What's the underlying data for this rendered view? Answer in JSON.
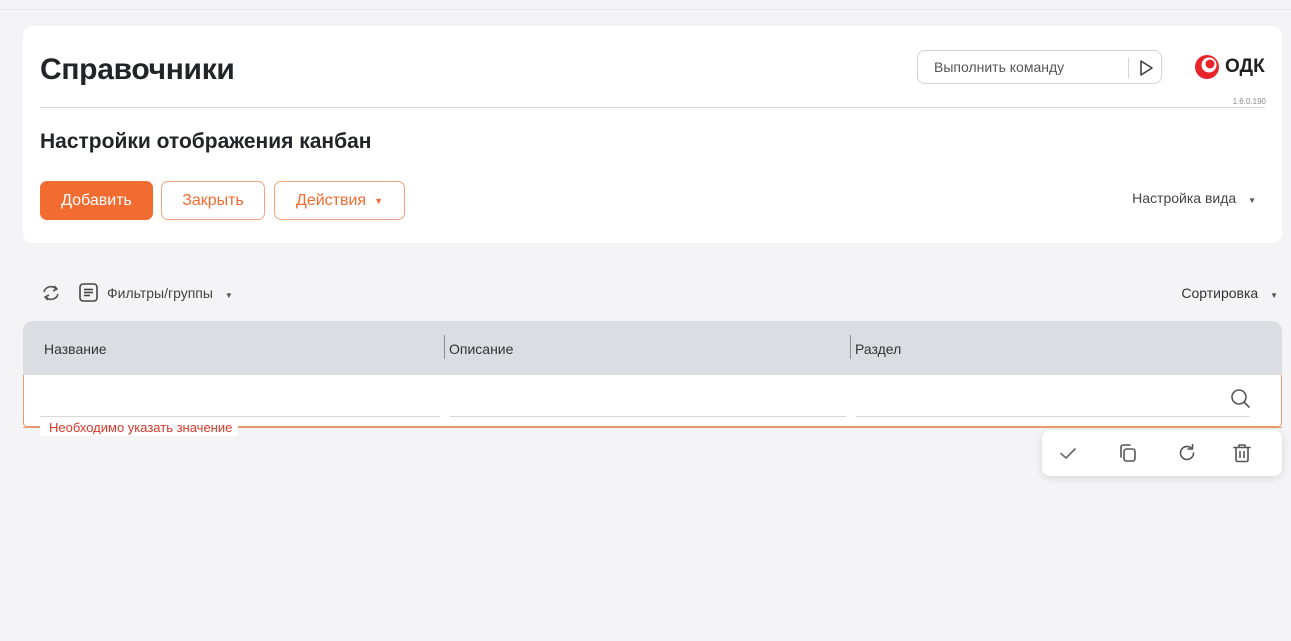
{
  "header": {
    "title": "Справочники",
    "command_placeholder": "Выполнить команду",
    "logo_text": "ОДК",
    "version": "1.6.0.190"
  },
  "section": {
    "title": "Настройки отображения канбан"
  },
  "actions": {
    "add_label": "Добавить",
    "close_label": "Закрыть",
    "actions_label": "Действия",
    "view_settings_label": "Настройка вида"
  },
  "toolbar": {
    "filters_label": "Фильтры/группы",
    "sort_label": "Сортировка"
  },
  "grid": {
    "columns": [
      "Название",
      "Описание",
      "Раздел"
    ],
    "filter_values": [
      "",
      "",
      ""
    ],
    "error_message": "Необходимо указать значение"
  },
  "icons": {
    "run": "play-triangle-icon",
    "logo": "odk-logo-icon",
    "refresh": "refresh-icon",
    "filter": "list-filter-icon",
    "search": "search-icon",
    "confirm": "check-icon",
    "copy": "copy-icon",
    "reset": "reload-icon",
    "delete": "trash-icon"
  },
  "colors": {
    "accent": "#f26b31",
    "error": "#d9382a",
    "header_bg": "#dcdde2",
    "page_bg": "#f4f4f6"
  }
}
